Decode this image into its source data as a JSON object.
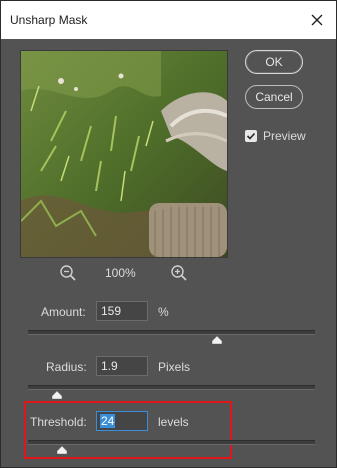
{
  "window": {
    "title": "Unsharp Mask"
  },
  "buttons": {
    "ok": "OK",
    "cancel": "Cancel"
  },
  "preview_toggle": {
    "label": "Preview",
    "checked": true
  },
  "zoom": {
    "level": "100%"
  },
  "params": {
    "amount": {
      "label": "Amount:",
      "value": "159",
      "unit": "%",
      "slider_fraction": 0.66
    },
    "radius": {
      "label": "Radius:",
      "value": "1.9",
      "unit": "Pixels",
      "slider_fraction": 0.1
    },
    "threshold": {
      "label": "Threshold:",
      "value": "24",
      "unit": "levels",
      "slider_fraction": 0.12
    }
  },
  "colors": {
    "highlight": "#e0151b",
    "selection": "#3a8ed8"
  },
  "icons": [
    "close-icon",
    "zoom-out-icon",
    "zoom-in-icon",
    "checkmark-icon",
    "slider-thumb-icon"
  ]
}
